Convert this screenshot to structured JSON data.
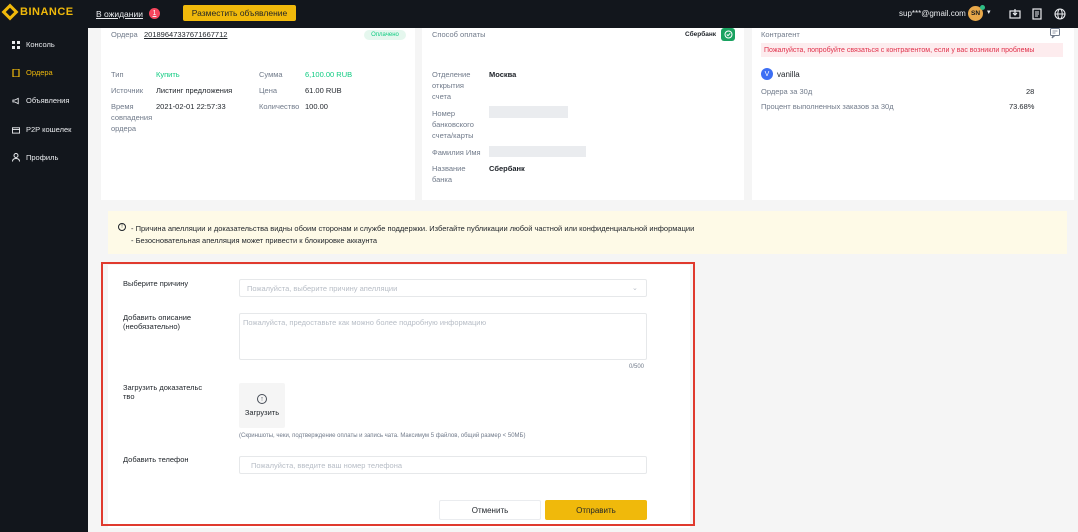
{
  "header": {
    "logo": "BINANCE",
    "pending_label": "В ожидании",
    "pending_count": "1",
    "post_ad_button": "Разместить объявление",
    "email": "sup***@gmail.com",
    "avatar_initials": "SN"
  },
  "sidebar": {
    "items": [
      {
        "label": "Консоль",
        "icon": "grid-icon"
      },
      {
        "label": "Ордера",
        "icon": "document-icon"
      },
      {
        "label": "Объявления",
        "icon": "megaphone-icon"
      },
      {
        "label": "P2P кошелек",
        "icon": "wallet-icon"
      },
      {
        "label": "Профиль",
        "icon": "user-icon"
      }
    ]
  },
  "order": {
    "order_label": "Ордера",
    "order_number": "20189647337671667712",
    "status": "Оплачено",
    "type_label": "Тип",
    "type_value": "Купить",
    "source_label": "Источник",
    "source_value": "Листинг предложения",
    "time_label": "Время совпадения ордера",
    "time_value": "2021-02-01 22:57:33",
    "amount_label": "Сумма",
    "amount_value": "6,100.00 RUB",
    "price_label": "Цена",
    "price_value": "61.00 RUB",
    "qty_label": "Количество",
    "qty_value": "100.00"
  },
  "payment": {
    "method_label": "Способ оплаты",
    "method_value": "Сбербанк",
    "branch_label": "Отделение открытия счета",
    "branch_value": "Москва",
    "account_label": "Номер банковского счета/карты",
    "name_label": "Фамилия Имя",
    "bank_label": "Название банка",
    "bank_value": "Сбербанк"
  },
  "counterparty": {
    "title": "Контрагент",
    "warning": "Пожалуйста, попробуйте связаться с контрагентом, если у вас возникли проблемы",
    "avatar_letter": "V",
    "username": "vanilla",
    "orders_30d_label": "Ордера за 30д",
    "orders_30d_value": "28",
    "completion_label": "Процент выполненных заказов за 30д",
    "completion_value": "73.68%"
  },
  "notice": {
    "line1": "- Причина апелляции и доказательства видны обоим сторонам и службе поддержки. Избегайте публикации любой частной или конфиденциальной информации",
    "line2": "- Безосновательная апелляция может привести к блокировке аккаунта"
  },
  "form": {
    "reason_label": "Выберите причину",
    "reason_placeholder": "Пожалуйста, выберите причину апелляции",
    "description_label": "Добавить описание (необязательно)",
    "description_placeholder": "Пожалуйста, предоставьте как можно более подробную информацию",
    "char_counter": "0/500",
    "upload_label": "Загрузить доказательство",
    "upload_button": "Загрузить",
    "upload_hint": "(Скриншоты, чеки, подтверждение оплаты и запись чата. Максимум 5 файлов, общий размер < 50МБ)",
    "phone_label": "Добавить телефон",
    "phone_placeholder": "Пожалуйста, введите ваш номер телефона",
    "cancel_button": "Отменить",
    "submit_button": "Отправить"
  },
  "colors": {
    "accent": "#f0b90b",
    "success": "#0ecb81",
    "danger": "#e0304a",
    "dark_bg": "#12161c",
    "highlight_border": "#e03a2e"
  }
}
